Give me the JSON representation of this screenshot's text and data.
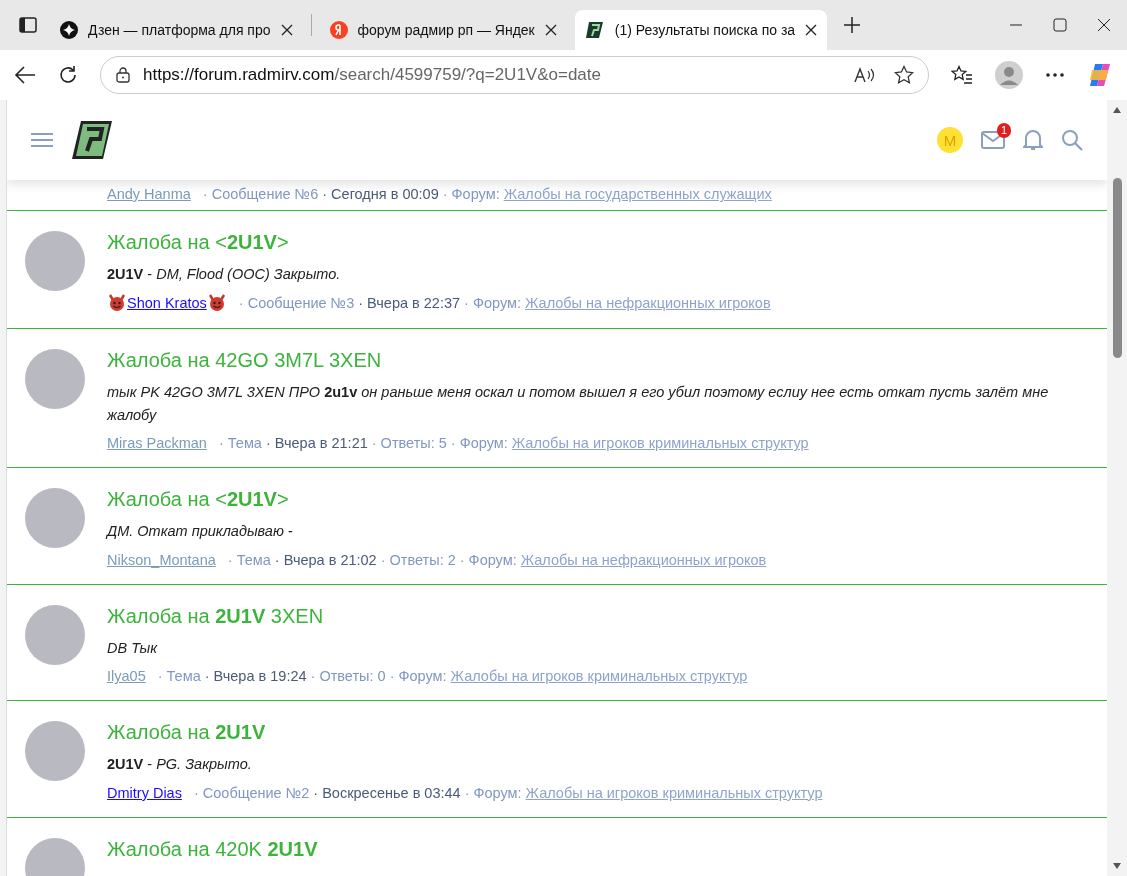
{
  "browser": {
    "tabs": [
      {
        "title": "Дзен — платформа для про",
        "selected": false
      },
      {
        "title": "форум радмир рп — Яндек",
        "selected": false
      },
      {
        "title": "(1) Результаты поиска по за",
        "selected": true
      }
    ],
    "address": {
      "host": "https://forum.radmirv.com",
      "path": "/search/4599759/?q=2U1V&o=date"
    }
  },
  "header": {
    "avatar_letter": "M",
    "inbox_count": "1"
  },
  "partial_meta": {
    "author": "Andy Hanma",
    "type": "· Сообщение №6",
    "date": "· Сегодня в 00:09",
    "forum_label": "· Форум:",
    "forum": "Жалобы на государственных служащих"
  },
  "results": [
    {
      "title": "Жалоба на <**2U1V**>",
      "snippet": "**2U1V** - *DM, Flood (OOC) Закрыто.*",
      "author": "Shon Kratos",
      "highlighted": true,
      "flair": true,
      "type": "· Сообщение №3",
      "date": "· Вчера в 22:37",
      "forum_label": "· Форум:",
      "forum": "Жалобы на нефракционных игроков"
    },
    {
      "title": "Жалоба на 42GO 3M7L 3XEN",
      "snippet": "*тык PK 42GO 3M7L 3XEN ПРО* **2u1v** *он раньше меня оскал и потом вышел я его убил поэтому еслиу нее есть откат пусть залёт мне жалобу*",
      "author": "Miras Packman",
      "highlighted": false,
      "flair": false,
      "type": "· Тема",
      "date": "· Вчера в 21:21",
      "replies": "· Ответы: 5",
      "forum_label": "· Форум:",
      "forum": "Жалобы на игроков криминальных структур"
    },
    {
      "title": "Жалоба на <**2U1V**>",
      "snippet": "*ДМ. Откат прикладываю -*",
      "author": "Nikson_Montana",
      "highlighted": false,
      "flair": false,
      "type": "· Тема",
      "date": "· Вчера в 21:02",
      "replies": "· Ответы: 2",
      "forum_label": "· Форум:",
      "forum": "Жалобы на нефракционных игроков"
    },
    {
      "title": "Жалоба на **2U1V** 3XEN",
      "snippet": "*DB Тык*",
      "author": "Ilya05",
      "highlighted": false,
      "flair": false,
      "type": "· Тема",
      "date": "· Вчера в 19:24",
      "replies": "· Ответы: 0",
      "forum_label": "· Форум:",
      "forum": "Жалобы на игроков криминальных структур"
    },
    {
      "title": "Жалоба на **2U1V**",
      "snippet": "**2U1V** - *PG. Закрыто.*",
      "author": "Dmitry Dias",
      "highlighted": true,
      "flair": false,
      "type": "· Сообщение №2",
      "date": "· Воскресенье в 03:44",
      "forum_label": "· Форум:",
      "forum": "Жалобы на игроков криминальных структур"
    },
    {
      "title": "Жалоба на 420K **2U1V**"
    }
  ]
}
